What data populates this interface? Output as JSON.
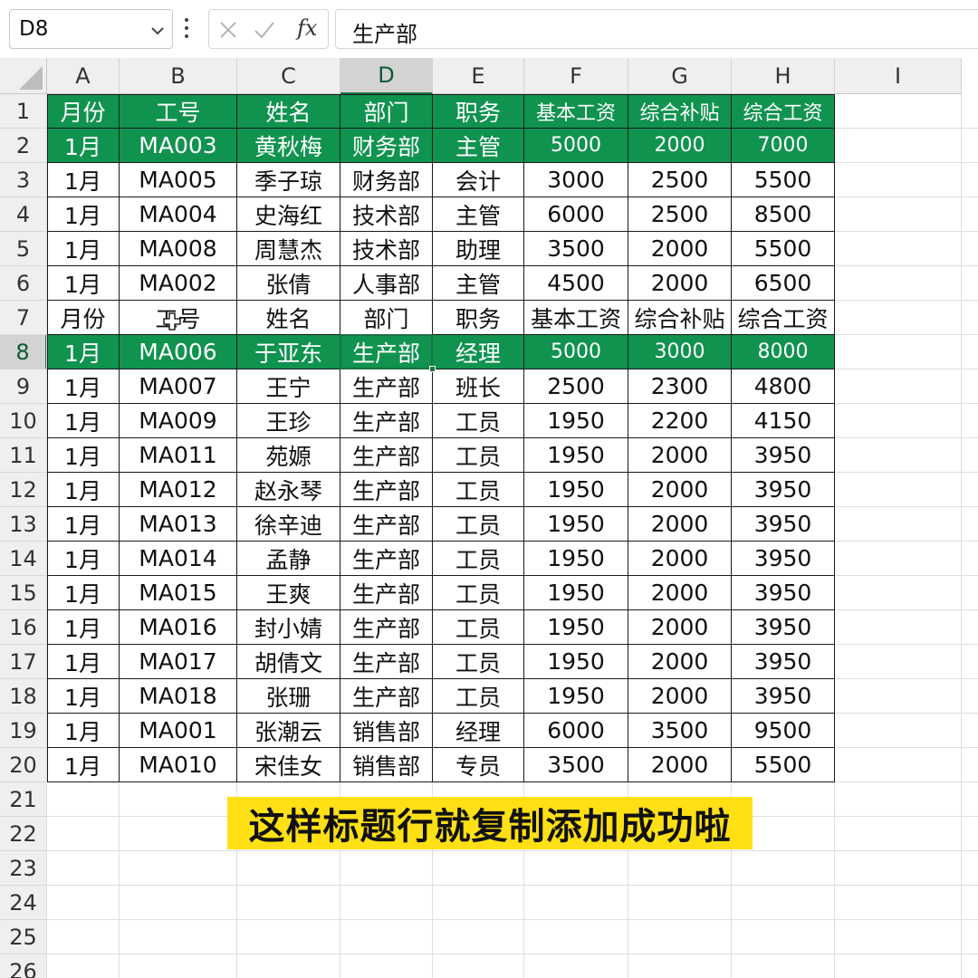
{
  "formula_bar": {
    "name_box": "D8",
    "cancel_icon": "close-icon",
    "confirm_icon": "check-icon",
    "fx_label": "fx",
    "content": "生产部"
  },
  "columns": [
    "A",
    "B",
    "C",
    "D",
    "E",
    "F",
    "G",
    "H",
    "I"
  ],
  "row_numbers": [
    "1",
    "2",
    "3",
    "4",
    "5",
    "6",
    "7",
    "8",
    "9",
    "10",
    "11",
    "12",
    "13",
    "14",
    "15",
    "16",
    "17",
    "18",
    "19",
    "20",
    "21",
    "22",
    "23",
    "24",
    "25",
    "26"
  ],
  "selected_cell": "D8",
  "table": {
    "header": [
      "月份",
      "工号",
      "姓名",
      "部门",
      "职务",
      "基本工资",
      "综合补贴",
      "综合工资"
    ],
    "rows": [
      [
        "1月",
        "MA003",
        "黄秋梅",
        "财务部",
        "主管",
        "5000",
        "2000",
        "7000"
      ],
      [
        "1月",
        "MA005",
        "季子琼",
        "财务部",
        "会计",
        "3000",
        "2500",
        "5500"
      ],
      [
        "1月",
        "MA004",
        "史海红",
        "技术部",
        "主管",
        "6000",
        "2500",
        "8500"
      ],
      [
        "1月",
        "MA008",
        "周慧杰",
        "技术部",
        "助理",
        "3500",
        "2000",
        "5500"
      ],
      [
        "1月",
        "MA002",
        "张倩",
        "人事部",
        "主管",
        "4500",
        "2000",
        "6500"
      ],
      [
        "月份",
        "工号",
        "姓名",
        "部门",
        "职务",
        "基本工资",
        "综合补贴",
        "综合工资"
      ],
      [
        "1月",
        "MA006",
        "于亚东",
        "生产部",
        "经理",
        "5000",
        "3000",
        "8000"
      ],
      [
        "1月",
        "MA007",
        "王宁",
        "生产部",
        "班长",
        "2500",
        "2300",
        "4800"
      ],
      [
        "1月",
        "MA009",
        "王珍",
        "生产部",
        "工员",
        "1950",
        "2200",
        "4150"
      ],
      [
        "1月",
        "MA011",
        "苑嫄",
        "生产部",
        "工员",
        "1950",
        "2000",
        "3950"
      ],
      [
        "1月",
        "MA012",
        "赵永琴",
        "生产部",
        "工员",
        "1950",
        "2000",
        "3950"
      ],
      [
        "1月",
        "MA013",
        "徐辛迪",
        "生产部",
        "工员",
        "1950",
        "2000",
        "3950"
      ],
      [
        "1月",
        "MA014",
        "孟静",
        "生产部",
        "工员",
        "1950",
        "2000",
        "3950"
      ],
      [
        "1月",
        "MA015",
        "王爽",
        "生产部",
        "工员",
        "1950",
        "2000",
        "3950"
      ],
      [
        "1月",
        "MA016",
        "封小婧",
        "生产部",
        "工员",
        "1950",
        "2000",
        "3950"
      ],
      [
        "1月",
        "MA017",
        "胡倩文",
        "生产部",
        "工员",
        "1950",
        "2000",
        "3950"
      ],
      [
        "1月",
        "MA018",
        "张珊",
        "生产部",
        "工员",
        "1950",
        "2000",
        "3950"
      ],
      [
        "1月",
        "MA001",
        "张潮云",
        "销售部",
        "经理",
        "6000",
        "3500",
        "9500"
      ],
      [
        "1月",
        "MA010",
        "宋佳女",
        "销售部",
        "专员",
        "3500",
        "2000",
        "5500"
      ]
    ],
    "header_row_indices": [
      0,
      6
    ]
  },
  "caption": "这样标题行就复制添加成功啦",
  "colors": {
    "header_fill": "#10934f",
    "header_text": "#ffffff",
    "selection": "#1e7145",
    "caption_bg": "#ffe014"
  }
}
